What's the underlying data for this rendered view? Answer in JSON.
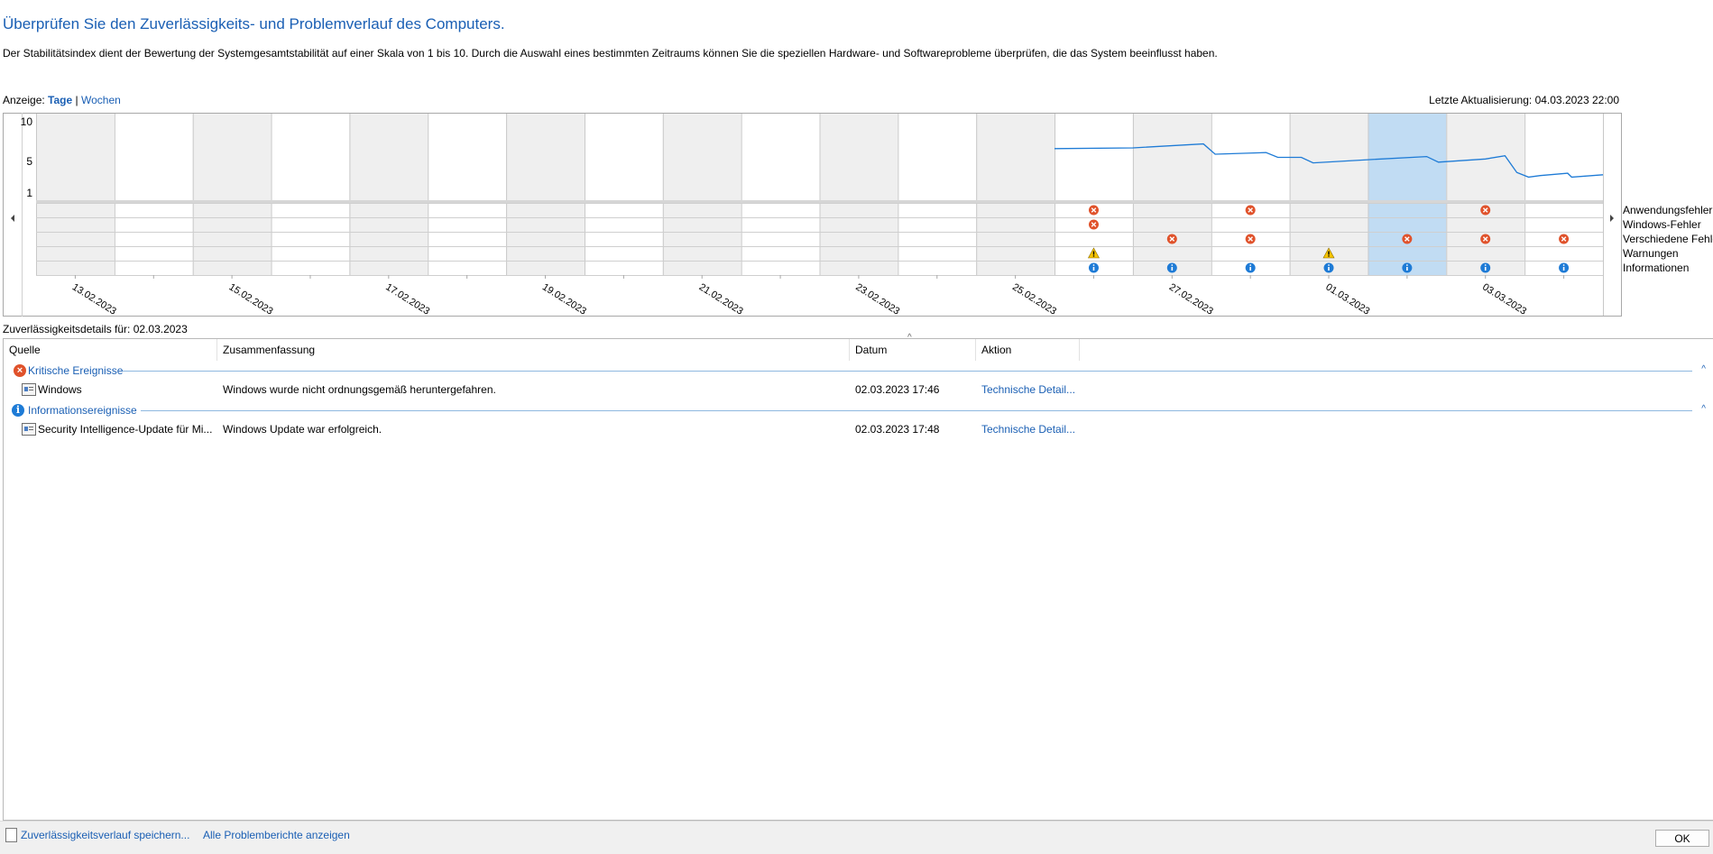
{
  "header": {
    "title": "Überprüfen Sie den Zuverlässigkeits- und Problemverlauf des Computers.",
    "description": "Der Stabilitätsindex dient der Bewertung der Systemgesamtstabilität auf einer Skala von 1 bis 10. Durch die Auswahl eines bestimmten Zeitraums können Sie die speziellen Hardware- und Softwareprobleme überprüfen, die das System beeinflusst haben.",
    "view_label": "Anzeige:",
    "view_days": "Tage",
    "view_separator": "|",
    "view_weeks": "Wochen",
    "last_update": "Letzte Aktualisierung: 04.03.2023 22:00"
  },
  "chart_data": {
    "type": "line",
    "y_ticks": [
      "10",
      "5",
      "1"
    ],
    "ylim": [
      1,
      10
    ],
    "date_labels": [
      "13.02.2023",
      "15.02.2023",
      "17.02.2023",
      "19.02.2023",
      "21.02.2023",
      "23.02.2023",
      "25.02.2023",
      "27.02.2023",
      "01.03.2023",
      "03.03.2023"
    ],
    "num_days": 20,
    "selected_day": 17,
    "categories": [
      "Anwendungsfehler",
      "Windows-Fehler",
      "Verschiedene Fehler",
      "Warnungen",
      "Informationen"
    ],
    "stability_index": [
      {
        "day": 13.0,
        "value": 6.6
      },
      {
        "day": 14.0,
        "value": 6.7
      },
      {
        "day": 14.9,
        "value": 7.2
      },
      {
        "day": 15.05,
        "value": 5.9
      },
      {
        "day": 15.7,
        "value": 6.1
      },
      {
        "day": 15.85,
        "value": 5.5
      },
      {
        "day": 16.15,
        "value": 5.5
      },
      {
        "day": 16.3,
        "value": 4.8
      },
      {
        "day": 17.0,
        "value": 5.2
      },
      {
        "day": 17.75,
        "value": 5.6
      },
      {
        "day": 17.9,
        "value": 4.9
      },
      {
        "day": 18.5,
        "value": 5.3
      },
      {
        "day": 18.75,
        "value": 5.7
      },
      {
        "day": 18.9,
        "value": 3.6
      },
      {
        "day": 19.05,
        "value": 3.0
      },
      {
        "day": 19.2,
        "value": 3.2
      },
      {
        "day": 19.55,
        "value": 3.5
      },
      {
        "day": 19.6,
        "value": 3.0
      },
      {
        "day": 20.0,
        "value": 3.3
      }
    ],
    "events": [
      {
        "day": 13,
        "category": 0,
        "icon": "error"
      },
      {
        "day": 15,
        "category": 0,
        "icon": "error"
      },
      {
        "day": 18,
        "category": 0,
        "icon": "error"
      },
      {
        "day": 13,
        "category": 1,
        "icon": "error"
      },
      {
        "day": 14,
        "category": 2,
        "icon": "error"
      },
      {
        "day": 15,
        "category": 2,
        "icon": "error"
      },
      {
        "day": 17,
        "category": 2,
        "icon": "error"
      },
      {
        "day": 18,
        "category": 2,
        "icon": "error"
      },
      {
        "day": 19,
        "category": 2,
        "icon": "error"
      },
      {
        "day": 13,
        "category": 3,
        "icon": "warning"
      },
      {
        "day": 16,
        "category": 3,
        "icon": "warning"
      },
      {
        "day": 13,
        "category": 4,
        "icon": "info"
      },
      {
        "day": 14,
        "category": 4,
        "icon": "info"
      },
      {
        "day": 15,
        "category": 4,
        "icon": "info"
      },
      {
        "day": 16,
        "category": 4,
        "icon": "info"
      },
      {
        "day": 17,
        "category": 4,
        "icon": "info"
      },
      {
        "day": 18,
        "category": 4,
        "icon": "info"
      },
      {
        "day": 19,
        "category": 4,
        "icon": "info"
      }
    ],
    "colors": {
      "line": "#1e7bd6",
      "selected": "#c1dcf3",
      "shaded": "#efefef",
      "error": "#e0522b",
      "warning": "#f6c400",
      "info": "#1e7bd6"
    }
  },
  "details": {
    "label": "Zuverlässigkeitsdetails für: 02.03.2023",
    "columns": {
      "source": "Quelle",
      "summary": "Zusammenfassung",
      "date": "Datum",
      "action": "Aktion"
    },
    "groups": [
      {
        "title": "Kritische Ereignisse",
        "icon": "error-icon",
        "rows": [
          {
            "source": "Windows",
            "summary": "Windows wurde nicht ordnungsgemäß heruntergefahren.",
            "date": "02.03.2023 17:46",
            "action": "Technische Detail..."
          }
        ]
      },
      {
        "title": "Informationsereignisse",
        "icon": "info-icon",
        "rows": [
          {
            "source": "Security Intelligence-Update für Mi...",
            "summary": "Windows Update war erfolgreich.",
            "date": "02.03.2023 17:48",
            "action": "Technische Detail..."
          }
        ]
      }
    ]
  },
  "footer": {
    "save_link": "Zuverlässigkeitsverlauf speichern...",
    "all_reports_link": "Alle Problemberichte anzeigen",
    "ok_label": "OK"
  }
}
